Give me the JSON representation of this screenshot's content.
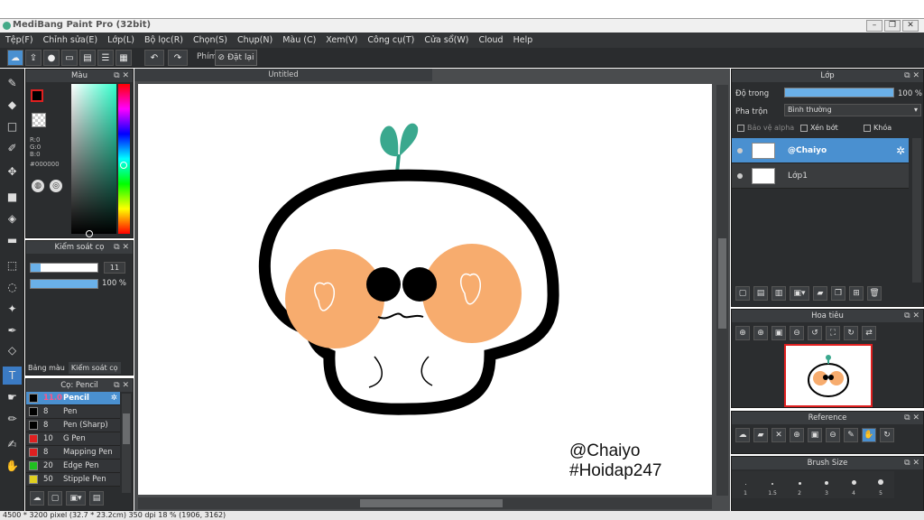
{
  "app": {
    "title": "MediBang Paint Pro (32bit)"
  },
  "menu": [
    "Tệp(F)",
    "Chỉnh sửa(E)",
    "Lớp(L)",
    "Bộ lọc(R)",
    "Chọn(S)",
    "Chụp(N)",
    "Màu (C)",
    "Xem(V)",
    "Công cụ(T)",
    "Cửa sổ(W)",
    "Cloud",
    "Help"
  ],
  "toolbar": {
    "phim_label": "Phím",
    "reset_label": "Đặt lại"
  },
  "color_panel": {
    "title": "Màu",
    "r": "R:0",
    "g": "G:0",
    "b": "B:0",
    "hex": "#000000",
    "fg_color": "#000000",
    "bg_color": "#ffffff"
  },
  "brush_control": {
    "title": "Kiểm soát cọ",
    "size": "11",
    "opacity": "100 %",
    "size_fraction": 0.15,
    "opacity_fraction": 1.0
  },
  "left_tabs": [
    "Bảng màu",
    "Kiểm soát cọ"
  ],
  "brush_panel": {
    "title": "Cọ: Pencil",
    "items": [
      {
        "size": "11.0",
        "name": "Pencil",
        "color": "#000000",
        "selected": true
      },
      {
        "size": "8",
        "name": "Pen",
        "color": "#000000"
      },
      {
        "size": "8",
        "name": "Pen (Sharp)",
        "color": "#000000"
      },
      {
        "size": "10",
        "name": "G Pen",
        "color": "#e02020"
      },
      {
        "size": "8",
        "name": "Mapping Pen",
        "color": "#e02020"
      },
      {
        "size": "20",
        "name": "Edge Pen",
        "color": "#20c020"
      },
      {
        "size": "50",
        "name": "Stipple Pen",
        "color": "#e0d020"
      }
    ]
  },
  "document": {
    "tab": "Untitled",
    "watermark_line1": "@Chaiyo",
    "watermark_line2": "#Hoidap247"
  },
  "layer_panel": {
    "title": "Lớp",
    "opacity_label": "Độ trong",
    "opacity_value": "100 %",
    "blend_label": "Pha trộn",
    "blend_value": "Bình thường",
    "protect_alpha": "Bảo vệ alpha",
    "clipping": "Xén bớt",
    "lock": "Khóa",
    "layers": [
      {
        "name": "@Chaiyo",
        "selected": true
      },
      {
        "name": "Lớp1"
      }
    ]
  },
  "navigator": {
    "title": "Hoa tiêu"
  },
  "reference": {
    "title": "Reference"
  },
  "brush_size": {
    "title": "Brush Size",
    "sizes": [
      "1",
      "1.5",
      "2",
      "3",
      "4",
      "5"
    ]
  },
  "status": {
    "text": "4500 * 3200 pixel  (32.7 * 23.2cm)  350 dpi  18 %  (1906, 3162)"
  },
  "accent": "#4a90d0"
}
